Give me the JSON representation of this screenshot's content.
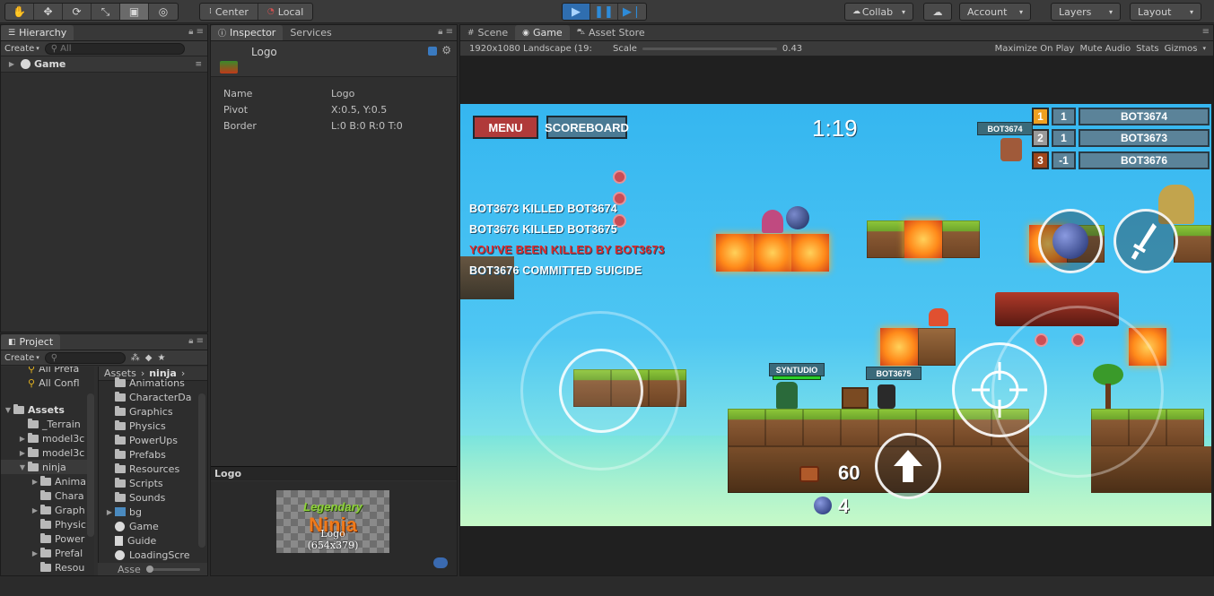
{
  "toolbar": {
    "tools": [
      "hand-tool",
      "move-tool",
      "rotate-tool",
      "scale-tool",
      "rect-tool",
      "transform-tool"
    ],
    "tool_glyphs": [
      "✋",
      "✥",
      "⟳",
      "⤡",
      "▣",
      "◎"
    ],
    "pivot": "Center",
    "space": "Local",
    "collab": "Collab",
    "account": "Account",
    "layers": "Layers",
    "layout": "Layout"
  },
  "hierarchy": {
    "tab": "Hierarchy",
    "create": "Create",
    "search_placeholder": "All",
    "scene": "Game"
  },
  "project": {
    "tab": "Project",
    "create": "Create",
    "favorites": [
      "All Prefa",
      "All Confl"
    ],
    "assets_label": "Assets",
    "tree": [
      "_Terrain",
      "model3c",
      "model3c",
      "ninja"
    ],
    "ninja_children": [
      "Anima",
      "Chara",
      "Graph",
      "Physic",
      "Power",
      "Prefal",
      "Resou"
    ],
    "breadcrumb": [
      "Assets",
      "ninja"
    ],
    "folders": [
      "Animations",
      "CharacterDa",
      "Graphics",
      "Physics",
      "PowerUps",
      "Prefabs",
      "Resources",
      "Scripts",
      "Sounds"
    ],
    "files": [
      "bg",
      "Game",
      "Guide",
      "LoadingScre"
    ],
    "footer": "Asse"
  },
  "inspector": {
    "tab": "Inspector",
    "tab2": "Services",
    "object_name": "Logo",
    "props": [
      {
        "k": "Name",
        "v": "Logo"
      },
      {
        "k": "Pivot",
        "v": "X:0.5, Y:0.5"
      },
      {
        "k": "Border",
        "v": "L:0 B:0 R:0 T:0"
      }
    ],
    "preview_title": "Logo",
    "preview_logo_line1": "Legendary",
    "preview_logo_line2": "Ninja",
    "preview_caption1": "Logo",
    "preview_caption2": "(654x379)"
  },
  "game": {
    "tab_scene": "Scene",
    "tab_game": "Game",
    "tab_store": "Asset Store",
    "resolution": "1920x1080 Landscape (19:",
    "scale_label": "Scale",
    "scale_value": "0.43",
    "maximize": "Maximize On Play",
    "mute": "Mute Audio",
    "stats": "Stats",
    "gizmos": "Gizmos",
    "menu_btn": "MENU",
    "scoreboard_btn": "SCOREBOARD",
    "timer": "1:19",
    "killfeed": [
      {
        "text": "BOT3673 KILLED BOT3674",
        "color": "#ffffff"
      },
      {
        "text": "BOT3676 KILLED BOT3675",
        "color": "#ffffff"
      },
      {
        "text": "YOU'VE BEEN KILLED BY BOT3673",
        "color": "#e02a2a"
      },
      {
        "text": "BOT3676 COMMITTED SUICIDE",
        "color": "#ffffff"
      }
    ],
    "scoreboard": [
      {
        "rank": "1",
        "points": "1",
        "name": "BOT3674",
        "color": "#f0a020"
      },
      {
        "rank": "2",
        "points": "1",
        "name": "BOT3673",
        "color": "#9a9a9a"
      },
      {
        "rank": "3",
        "points": "-1",
        "name": "BOT3676",
        "color": "#a0461c"
      }
    ],
    "tag_top": "BOT3674",
    "tag_player": "SYNTUDIO",
    "tag_enemy": "BOT3675",
    "coins": "60",
    "bombs": "4"
  }
}
